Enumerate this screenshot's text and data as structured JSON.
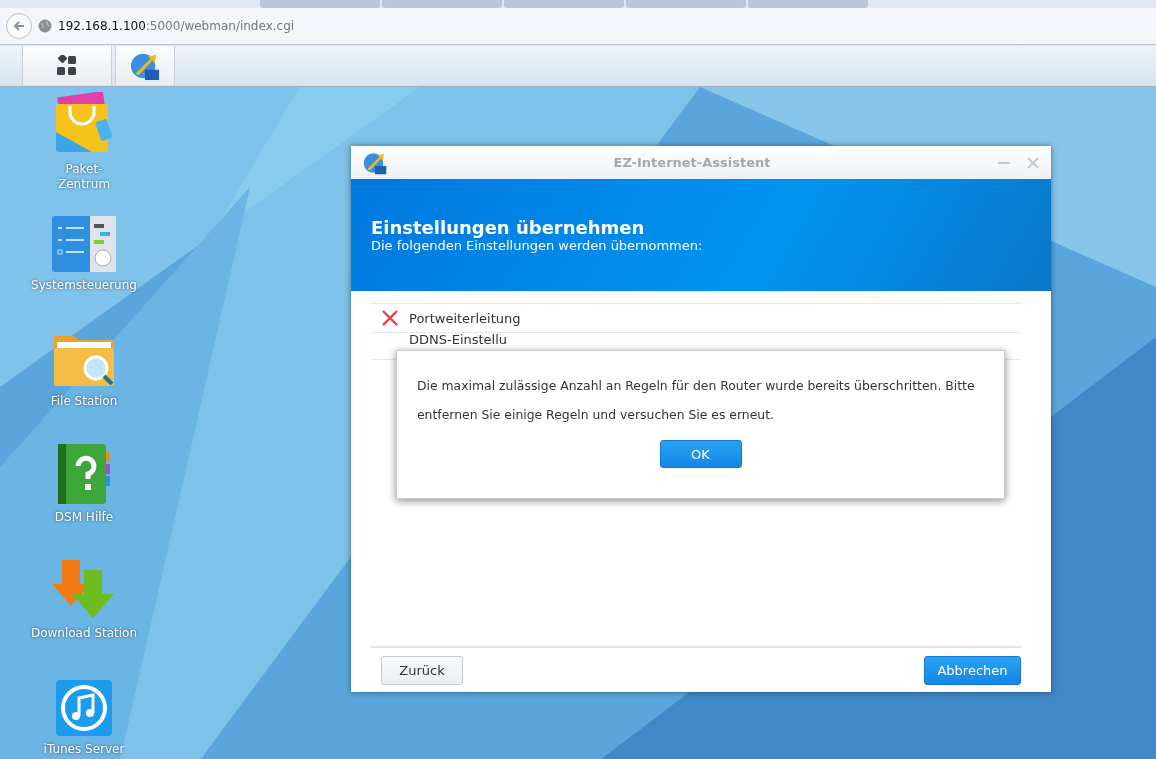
{
  "browser": {
    "url_host": "192.168.1.100",
    "url_path": ":5000/webman/index.cgi"
  },
  "desktop_icons": [
    {
      "kind": "package",
      "label": "Paket-\nZentrum"
    },
    {
      "kind": "control",
      "label": "Systemsteuerung"
    },
    {
      "kind": "files",
      "label": "File Station"
    },
    {
      "kind": "help",
      "label": "DSM Hilfe"
    },
    {
      "kind": "download",
      "label": "Download Station"
    },
    {
      "kind": "music",
      "label": "iTunes Server"
    }
  ],
  "wizard": {
    "title": "EZ-Internet-Assistent",
    "heading": "Einstellungen übernehmen",
    "subheading": "Die folgenden Einstellungen werden übernommen:",
    "items": [
      {
        "label": "Portweiterleitung",
        "failed": true
      },
      {
        "label": "DDNS-Einstellu"
      }
    ],
    "back_button": "Zurück",
    "cancel_button": "Abbrechen"
  },
  "message_box": {
    "text": "Die maximal zulässige Anzahl an Regeln für den Router wurde bereits überschritten. Bitte entfernen Sie einige Regeln und versuchen Sie es erneut.",
    "ok_button": "OK"
  }
}
